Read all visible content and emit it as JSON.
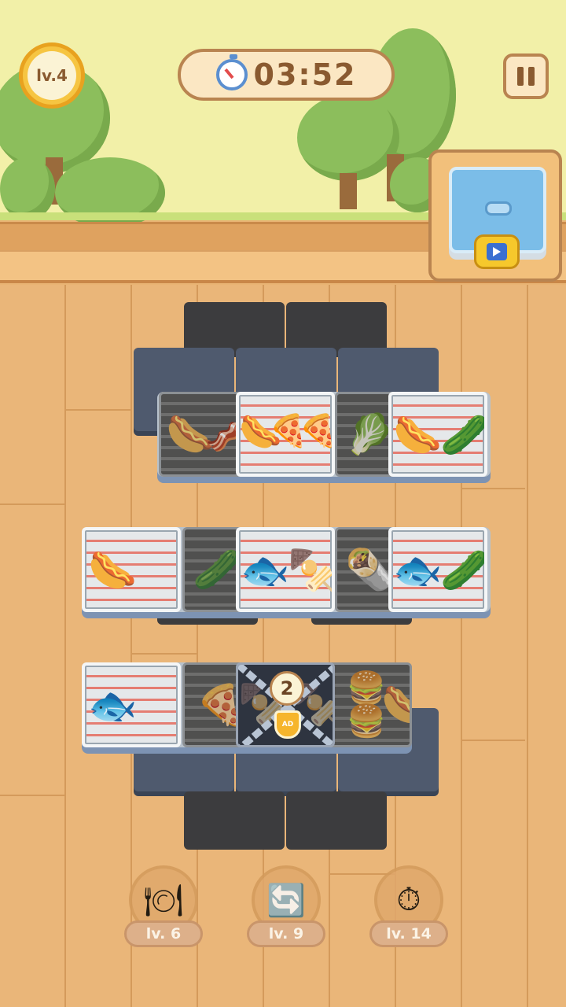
{
  "hud": {
    "level_label": "lv.4",
    "timer": "03:52",
    "icons": {
      "timer": "stopwatch-icon",
      "pause": "pause-icon",
      "fridge": "freezer-icon",
      "video": "video-ad-icon"
    }
  },
  "locked_tile": {
    "count": "2",
    "ad_label": "AD"
  },
  "boosters": [
    {
      "icon": "utensils-tray-icon",
      "level": "lv. 6"
    },
    {
      "icon": "shuffle-arrows-icon",
      "level": "lv. 9"
    },
    {
      "icon": "freeze-clock-icon",
      "level": "lv. 14"
    }
  ],
  "grill_rows": [
    {
      "cells": [
        [
          "sausage",
          "bacon"
        ],
        [
          "hotdog",
          "pizza",
          "pizza"
        ],
        [
          "lettuce"
        ],
        [
          "hotdog",
          "asparagus"
        ]
      ]
    },
    {
      "cells": [
        [
          "hotdog"
        ],
        [
          "asparagus"
        ],
        [
          "fish",
          "kebab"
        ],
        [
          "wrap"
        ],
        [
          "fish",
          "asparagus"
        ]
      ]
    },
    {
      "cells": [
        [
          "fish"
        ],
        [
          "pizza"
        ],
        [
          "locked"
        ],
        [
          "burger",
          "burger",
          "hotdog"
        ]
      ]
    }
  ]
}
